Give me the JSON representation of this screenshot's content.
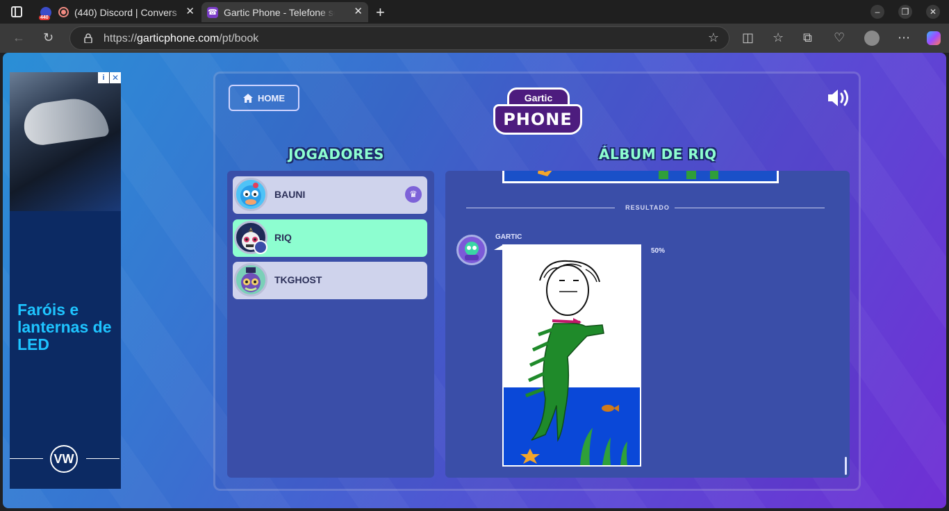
{
  "browser": {
    "tabs": [
      {
        "title": "(440) Discord | Convers",
        "badge": "440"
      },
      {
        "title": "Gartic Phone - Telefone sem fio"
      }
    ],
    "url_prefix": "https://",
    "url_host": "garticphone.com",
    "url_path": "/pt/book"
  },
  "ad": {
    "headline": "Faróis e lanternas de LED",
    "brand_icon": "vw-logo-icon"
  },
  "game": {
    "home_label": "HOME",
    "logo_top": "Gartic",
    "logo_main": "PHONE",
    "players_title": "JOGADORES",
    "album_title": "ÁLBUM DE RIQ",
    "players": [
      {
        "name": "BAUNI",
        "host": true,
        "active": false
      },
      {
        "name": "RIQ",
        "host": false,
        "active": true
      },
      {
        "name": "TKGHOST",
        "host": false,
        "active": false
      }
    ],
    "result_label": "RESULTADO",
    "author": "GARTIC",
    "score": "50%"
  }
}
